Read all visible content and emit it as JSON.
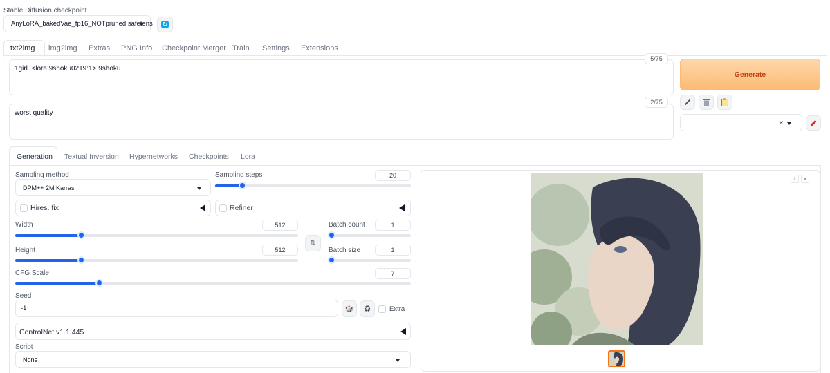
{
  "checkpoint": {
    "label": "Stable Diffusion checkpoint",
    "value": "AnyLoRA_bakedVae_fp16_NOTpruned.safetens"
  },
  "main_tabs": [
    {
      "label": "txt2img"
    },
    {
      "label": "img2img"
    },
    {
      "label": "Extras"
    },
    {
      "label": "PNG Info"
    },
    {
      "label": "Checkpoint Merger"
    },
    {
      "label": "Train"
    },
    {
      "label": "Settings"
    },
    {
      "label": "Extensions"
    }
  ],
  "prompt": {
    "positive": "1girl  <lora:9shoku0219:1> 9shoku",
    "positive_count": "5/75",
    "negative": "worst quality",
    "negative_count": "2/75"
  },
  "generate": {
    "label": "Generate"
  },
  "styles": {
    "clear_glyph": "×"
  },
  "sub_tabs": [
    {
      "label": "Generation"
    },
    {
      "label": "Textual Inversion"
    },
    {
      "label": "Hypernetworks"
    },
    {
      "label": "Checkpoints"
    },
    {
      "label": "Lora"
    }
  ],
  "generation": {
    "sampling_method_label": "Sampling method",
    "sampling_method_value": "DPM++ 2M Karras",
    "sampling_steps_label": "Sampling steps",
    "sampling_steps_value": "20",
    "hires_fix_label": "Hires. fix",
    "refiner_label": "Refiner",
    "width_label": "Width",
    "width_value": "512",
    "height_label": "Height",
    "height_value": "512",
    "batch_count_label": "Batch count",
    "batch_count_value": "1",
    "batch_size_label": "Batch size",
    "batch_size_value": "1",
    "cfg_label": "CFG Scale",
    "cfg_value": "7",
    "seed_label": "Seed",
    "seed_value": "-1",
    "extra_label": "Extra",
    "controlnet_label": "ControlNet v1.1.445",
    "script_label": "Script",
    "script_value": "None",
    "swap_glyph": "⇅",
    "dice_glyph": "🎲",
    "recycle_glyph": "♻"
  },
  "colors": {
    "accent": "#2563eb",
    "generate_text": "#c2410c",
    "generate_bg_top": "#fed7aa",
    "generate_bg_bottom": "#fdba74"
  },
  "icons": [
    "refresh-icon",
    "pencil-icon",
    "trash-icon",
    "clipboard-icon",
    "paint-brush-icon",
    "download-icon",
    "close-icon"
  ]
}
